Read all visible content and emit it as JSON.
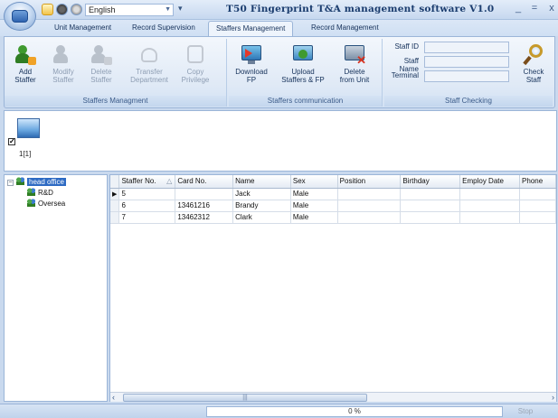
{
  "titlebar": {
    "language": "English",
    "app_title": "T50 Fingerprint T&A management software V1.0",
    "min": "_",
    "max": "=",
    "close": "x"
  },
  "tabs": [
    {
      "label": "Unit Management",
      "active": false
    },
    {
      "label": "Record Supervision",
      "active": false
    },
    {
      "label": "Staffers Management",
      "active": true
    },
    {
      "label": "Record Management",
      "active": false
    }
  ],
  "ribbon": {
    "groups": {
      "staffers_managment": "Staffers Managment",
      "staffers_communication": "Staffers communication",
      "staff_checking": "Staff Checking"
    },
    "buttons": {
      "add_staffer": "Add\nStaffer",
      "modify_staffer": "Modify\nStaffer",
      "delete_staffer": "Delete\nStaffer",
      "transfer_department": "Transfer\nDepartment",
      "copy_privilege": "Copy\nPrivilege",
      "download_fp": "Download\nFP",
      "upload_staffers_fp": "Upload\nStaffers & FP",
      "delete_from_unit": "Delete\nfrom Unit",
      "check_staff": "Check\nStaff"
    },
    "check_fields": {
      "staff_id": "Staff ID",
      "staff_name": "Staff Name",
      "terminal": "Terminal"
    }
  },
  "device": {
    "label": "1[1]",
    "checked": true
  },
  "tree": {
    "root": "head office",
    "children": [
      "R&D",
      "Oversea"
    ]
  },
  "grid": {
    "columns": [
      "Staffer No.",
      "Card No.",
      "Name",
      "Sex",
      "Position",
      "Birthday",
      "Employ Date",
      "Phone"
    ],
    "sort_glyph": "△",
    "rows": [
      {
        "current": true,
        "cells": [
          "5",
          "",
          "Jack",
          "Male",
          "",
          "",
          "",
          ""
        ]
      },
      {
        "current": false,
        "cells": [
          "6",
          "13461216",
          "Brandy",
          "Male",
          "",
          "",
          "",
          ""
        ]
      },
      {
        "current": false,
        "cells": [
          "7",
          "13462312",
          "Clark",
          "Male",
          "",
          "",
          "",
          ""
        ]
      }
    ]
  },
  "status": {
    "progress": "0 %",
    "progress_value": 0,
    "stop": "Stop"
  },
  "colors": {
    "accent": "#2d6ac3",
    "ribbon_bg": "#dfe9f6"
  }
}
